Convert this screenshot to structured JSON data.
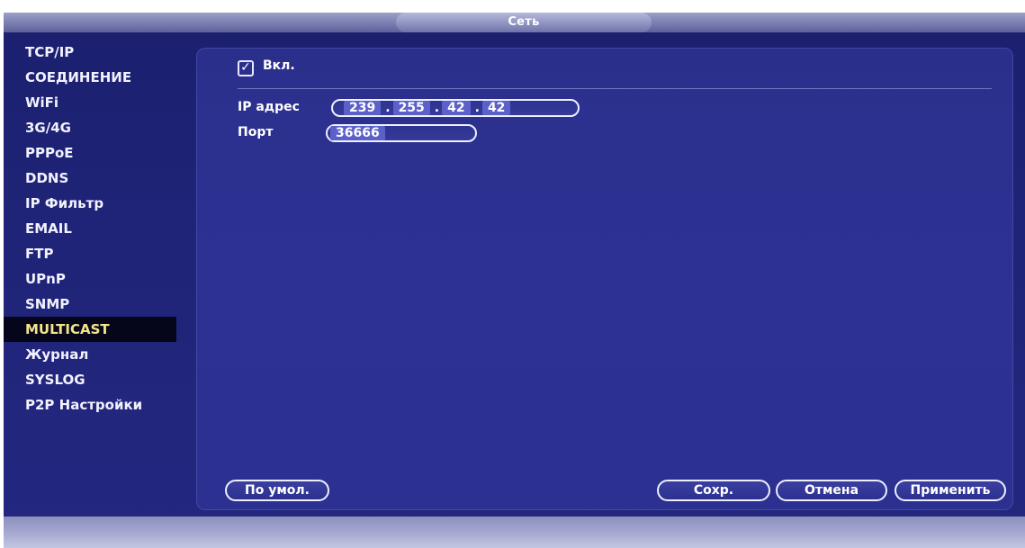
{
  "window": {
    "title": "Сеть"
  },
  "sidebar": {
    "items": [
      {
        "label": "TCP/IP"
      },
      {
        "label": "СОЕДИНЕНИЕ"
      },
      {
        "label": "WiFi"
      },
      {
        "label": "3G/4G"
      },
      {
        "label": "PPPoE"
      },
      {
        "label": "DDNS"
      },
      {
        "label": "IP Фильтр"
      },
      {
        "label": "EMAIL"
      },
      {
        "label": "FTP"
      },
      {
        "label": "UPnP"
      },
      {
        "label": "SNMP"
      },
      {
        "label": "MULTICAST",
        "active": true
      },
      {
        "label": "Журнал"
      },
      {
        "label": "SYSLOG"
      },
      {
        "label": "P2P Настройки"
      }
    ]
  },
  "multicast": {
    "enable_label": "Вкл.",
    "enable_checked": true,
    "check_mark": "✓",
    "ip_label": "IP адрес",
    "ip_octets": [
      "239",
      "255",
      "42",
      "42"
    ],
    "ip_separator": ".",
    "port_label": "Порт",
    "port_value": "36666"
  },
  "buttons": {
    "default_label": "По умол.",
    "save_label": "Сохр.",
    "cancel_label": "Отмена",
    "apply_label": "Применить"
  },
  "colors": {
    "background": "#23277f",
    "panel": "#2d3192",
    "active_item_bg": "#06061a",
    "active_item_text": "#f3e58a",
    "field_highlight": "#5c61ca",
    "title_bar": "#7c80b2"
  }
}
